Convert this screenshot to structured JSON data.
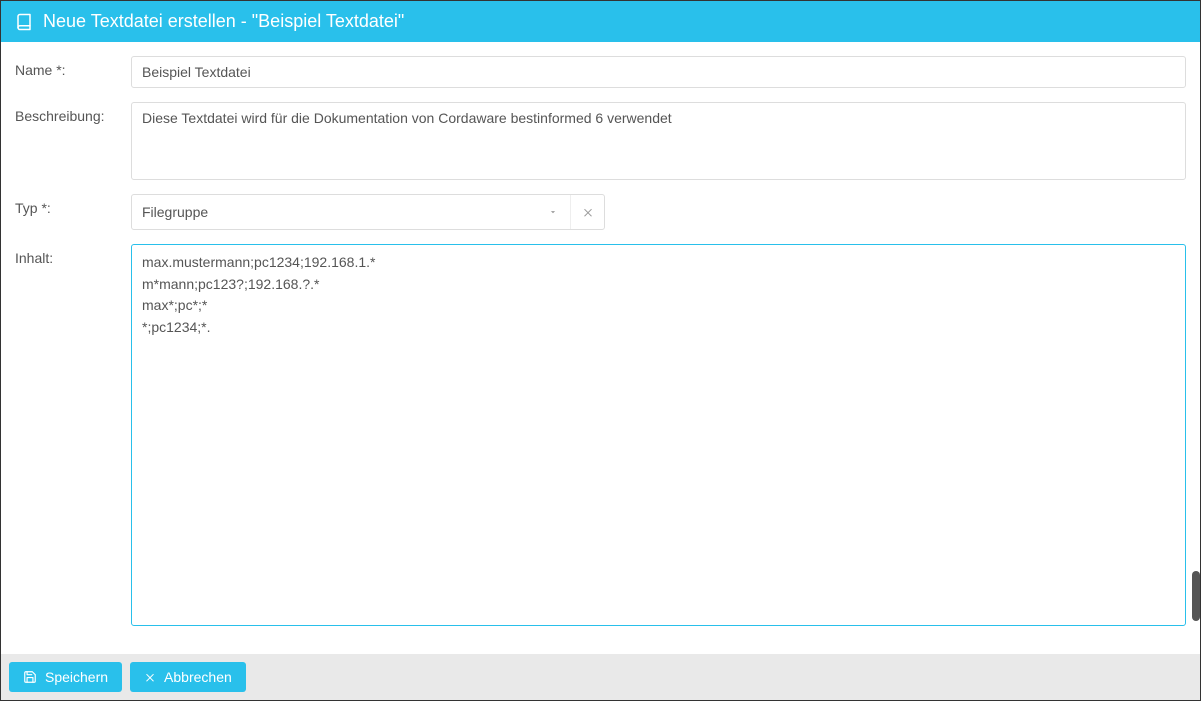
{
  "header": {
    "title": "Neue Textdatei erstellen - \"Beispiel Textdatei\""
  },
  "labels": {
    "name": "Name *:",
    "description": "Beschreibung:",
    "type": "Typ *:",
    "content": "Inhalt:"
  },
  "fields": {
    "name": "Beispiel Textdatei",
    "description": "Diese Textdatei wird für die Dokumentation von Cordaware bestinformed 6 verwendet",
    "type": "Filegruppe",
    "content": "max.mustermann;pc1234;192.168.1.*\nm*mann;pc123?;192.168.?.*\nmax*;pc*;*\n*;pc1234;*."
  },
  "buttons": {
    "save": "Speichern",
    "cancel": "Abbrechen"
  }
}
